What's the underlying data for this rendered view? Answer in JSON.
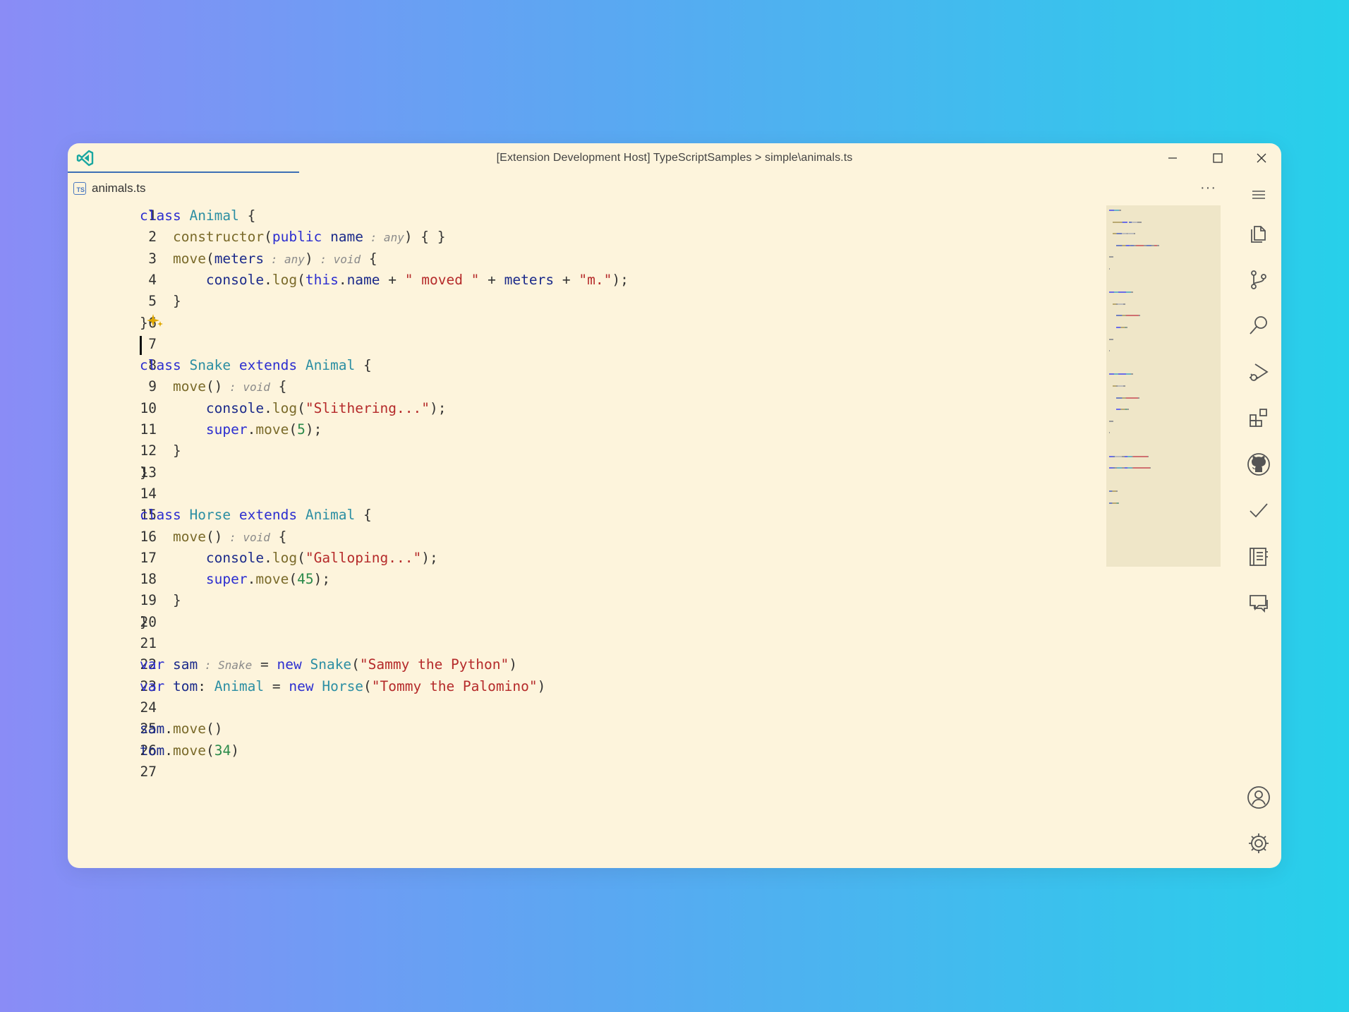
{
  "window": {
    "title": "[Extension Development Host] TypeScriptSamples > simple\\animals.ts"
  },
  "tab": {
    "label": "animals.ts",
    "badge": "TS"
  },
  "toolbar": {
    "more": "···"
  },
  "editor": {
    "lines": [
      [
        {
          "t": "class ",
          "c": "kw"
        },
        {
          "t": "Animal",
          "c": "cls"
        },
        {
          "t": " {",
          "c": "p"
        }
      ],
      [
        {
          "t": "    ",
          "c": "p"
        },
        {
          "t": "constructor",
          "c": "fn"
        },
        {
          "t": "(",
          "c": "p"
        },
        {
          "t": "public",
          "c": "kw"
        },
        {
          "t": " ",
          "c": "p"
        },
        {
          "t": "name",
          "c": "var"
        },
        {
          "t": " : any",
          "c": "hint"
        },
        {
          "t": ") { }",
          "c": "p"
        }
      ],
      [
        {
          "t": "    ",
          "c": "p"
        },
        {
          "t": "move",
          "c": "fn"
        },
        {
          "t": "(",
          "c": "p"
        },
        {
          "t": "meters",
          "c": "var"
        },
        {
          "t": " : any",
          "c": "hint"
        },
        {
          "t": ")",
          "c": "p"
        },
        {
          "t": " : void",
          "c": "hint"
        },
        {
          "t": " {",
          "c": "p"
        }
      ],
      [
        {
          "t": "        ",
          "c": "p"
        },
        {
          "t": "console",
          "c": "var"
        },
        {
          "t": ".",
          "c": "p"
        },
        {
          "t": "log",
          "c": "fn"
        },
        {
          "t": "(",
          "c": "p"
        },
        {
          "t": "this",
          "c": "kw"
        },
        {
          "t": ".",
          "c": "p"
        },
        {
          "t": "name",
          "c": "var"
        },
        {
          "t": " + ",
          "c": "p"
        },
        {
          "t": "\" moved \"",
          "c": "str"
        },
        {
          "t": " + ",
          "c": "p"
        },
        {
          "t": "meters",
          "c": "var"
        },
        {
          "t": " + ",
          "c": "p"
        },
        {
          "t": "\"m.\"",
          "c": "str"
        },
        {
          "t": ");",
          "c": "p"
        }
      ],
      [
        {
          "t": "    }",
          "c": "p"
        }
      ],
      [
        {
          "t": "}",
          "c": "p"
        }
      ],
      [],
      [
        {
          "t": "class ",
          "c": "kw"
        },
        {
          "t": "Snake",
          "c": "cls"
        },
        {
          "t": " extends ",
          "c": "kw"
        },
        {
          "t": "Animal",
          "c": "cls"
        },
        {
          "t": " {",
          "c": "p"
        }
      ],
      [
        {
          "t": "    ",
          "c": "p"
        },
        {
          "t": "move",
          "c": "fn"
        },
        {
          "t": "()",
          "c": "p"
        },
        {
          "t": " : void",
          "c": "hint"
        },
        {
          "t": " {",
          "c": "p"
        }
      ],
      [
        {
          "t": "        ",
          "c": "p"
        },
        {
          "t": "console",
          "c": "var"
        },
        {
          "t": ".",
          "c": "p"
        },
        {
          "t": "log",
          "c": "fn"
        },
        {
          "t": "(",
          "c": "p"
        },
        {
          "t": "\"Slithering...\"",
          "c": "str"
        },
        {
          "t": ");",
          "c": "p"
        }
      ],
      [
        {
          "t": "        ",
          "c": "p"
        },
        {
          "t": "super",
          "c": "kw"
        },
        {
          "t": ".",
          "c": "p"
        },
        {
          "t": "move",
          "c": "fn"
        },
        {
          "t": "(",
          "c": "p"
        },
        {
          "t": "5",
          "c": "num"
        },
        {
          "t": ");",
          "c": "p"
        }
      ],
      [
        {
          "t": "    }",
          "c": "p"
        }
      ],
      [
        {
          "t": "}",
          "c": "p"
        }
      ],
      [],
      [
        {
          "t": "class ",
          "c": "kw"
        },
        {
          "t": "Horse",
          "c": "cls"
        },
        {
          "t": " extends ",
          "c": "kw"
        },
        {
          "t": "Animal",
          "c": "cls"
        },
        {
          "t": " {",
          "c": "p"
        }
      ],
      [
        {
          "t": "    ",
          "c": "p"
        },
        {
          "t": "move",
          "c": "fn"
        },
        {
          "t": "()",
          "c": "p"
        },
        {
          "t": " : void",
          "c": "hint"
        },
        {
          "t": " {",
          "c": "p"
        }
      ],
      [
        {
          "t": "        ",
          "c": "p"
        },
        {
          "t": "console",
          "c": "var"
        },
        {
          "t": ".",
          "c": "p"
        },
        {
          "t": "log",
          "c": "fn"
        },
        {
          "t": "(",
          "c": "p"
        },
        {
          "t": "\"Galloping...\"",
          "c": "str"
        },
        {
          "t": ");",
          "c": "p"
        }
      ],
      [
        {
          "t": "        ",
          "c": "p"
        },
        {
          "t": "super",
          "c": "kw"
        },
        {
          "t": ".",
          "c": "p"
        },
        {
          "t": "move",
          "c": "fn"
        },
        {
          "t": "(",
          "c": "p"
        },
        {
          "t": "45",
          "c": "num"
        },
        {
          "t": ");",
          "c": "p"
        }
      ],
      [
        {
          "t": "    }",
          "c": "p"
        }
      ],
      [
        {
          "t": "}",
          "c": "p"
        }
      ],
      [],
      [
        {
          "t": "var ",
          "c": "kw"
        },
        {
          "t": "sam",
          "c": "var"
        },
        {
          "t": " : Snake",
          "c": "hint"
        },
        {
          "t": " = ",
          "c": "p"
        },
        {
          "t": "new ",
          "c": "kw"
        },
        {
          "t": "Snake",
          "c": "cls"
        },
        {
          "t": "(",
          "c": "p"
        },
        {
          "t": "\"Sammy the Python\"",
          "c": "str"
        },
        {
          "t": ")",
          "c": "p"
        }
      ],
      [
        {
          "t": "var ",
          "c": "kw"
        },
        {
          "t": "tom",
          "c": "var"
        },
        {
          "t": ": ",
          "c": "p"
        },
        {
          "t": "Animal",
          "c": "cls"
        },
        {
          "t": " = ",
          "c": "p"
        },
        {
          "t": "new ",
          "c": "kw"
        },
        {
          "t": "Horse",
          "c": "cls"
        },
        {
          "t": "(",
          "c": "p"
        },
        {
          "t": "\"Tommy the Palomino\"",
          "c": "str"
        },
        {
          "t": ")",
          "c": "p"
        }
      ],
      [],
      [
        {
          "t": "sam",
          "c": "var"
        },
        {
          "t": ".",
          "c": "p"
        },
        {
          "t": "move",
          "c": "fn"
        },
        {
          "t": "()",
          "c": "p"
        }
      ],
      [
        {
          "t": "tom",
          "c": "var"
        },
        {
          "t": ".",
          "c": "p"
        },
        {
          "t": "move",
          "c": "fn"
        },
        {
          "t": "(",
          "c": "p"
        },
        {
          "t": "34",
          "c": "num"
        },
        {
          "t": ")",
          "c": "p"
        }
      ],
      []
    ],
    "cursor_line": 7,
    "sparkle_line": 6
  },
  "activity_bar": {
    "items": [
      "menu-icon",
      "explorer-icon",
      "source-control-icon",
      "search-icon",
      "run-debug-icon",
      "extensions-icon",
      "github-icon",
      "testing-icon",
      "notebook-icon",
      "chat-icon"
    ],
    "bottom": [
      "account-icon",
      "settings-gear-icon"
    ]
  },
  "colors": {
    "background": "#fdf4dc",
    "keyword": "#2c2ed0",
    "class": "#2b8ea3",
    "function": "#7a6a2a",
    "string": "#b52a2a",
    "number": "#2a8a4a"
  }
}
